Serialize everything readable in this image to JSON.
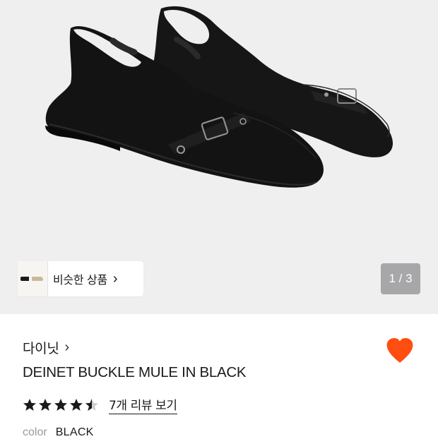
{
  "gallery": {
    "similar_label": "비슷한 상품",
    "similar_chevron": "›",
    "page_indicator": "1 / 3",
    "image_alt": "black pointed-toe slingback flats with buckle strap"
  },
  "product": {
    "brand": "다이닛",
    "brand_chevron": "›",
    "title": "DEINET BUCKLE MULE IN BLACK",
    "rating": 4.5,
    "review_link": "7개 리뷰 보기",
    "color_label": "color",
    "color_value": "BLACK",
    "wishlisted": true
  },
  "colors": {
    "heart": "#FF4E0F",
    "gallery_bg": "#EFEFF0",
    "indicator_bg": "#A7A7A9",
    "star": "#1A1A1A"
  }
}
